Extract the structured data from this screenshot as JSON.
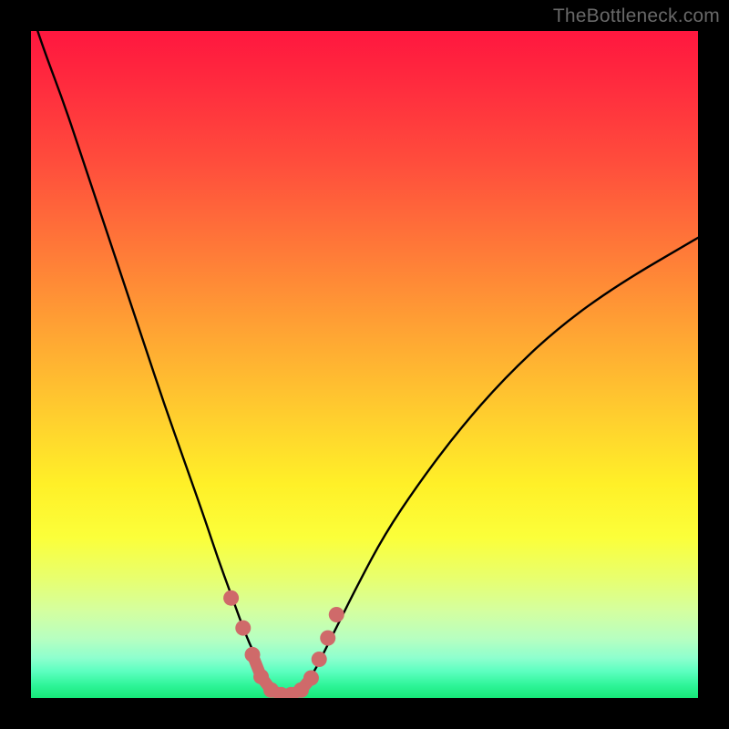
{
  "watermark": "TheBottleneck.com",
  "colors": {
    "background": "#000000",
    "curve": "#000000",
    "marker_fill": "#cf6a6a",
    "marker_stroke": "#cf6a6a"
  },
  "chart_data": {
    "type": "line",
    "title": "",
    "xlabel": "",
    "ylabel": "",
    "xlim": [
      0,
      100
    ],
    "ylim": [
      0,
      100
    ],
    "grid": false,
    "legend": false,
    "series": [
      {
        "name": "bottleneck-curve",
        "x": [
          0,
          2,
          5,
          8,
          11,
          14,
          17,
          20,
          23,
          26,
          28,
          30,
          32,
          33.5,
          35,
          36,
          37,
          38,
          39,
          40,
          41,
          42.5,
          44,
          46,
          49,
          53,
          58,
          64,
          71,
          79,
          88,
          100
        ],
        "y": [
          103,
          97,
          89,
          80,
          71,
          62,
          53,
          44,
          35.5,
          27,
          21,
          15.5,
          10,
          6.5,
          3.5,
          2,
          1,
          0.5,
          0.5,
          1,
          2,
          4,
          7,
          11,
          17,
          24.5,
          32,
          40,
          48,
          55.5,
          62,
          69
        ]
      }
    ],
    "markers": {
      "name": "highlighted-points",
      "points": [
        {
          "x": 30.0,
          "y": 15.0
        },
        {
          "x": 31.8,
          "y": 10.5
        },
        {
          "x": 33.2,
          "y": 6.5
        },
        {
          "x": 34.5,
          "y": 3.2
        },
        {
          "x": 36.0,
          "y": 1.2
        },
        {
          "x": 37.5,
          "y": 0.5
        },
        {
          "x": 39.0,
          "y": 0.5
        },
        {
          "x": 40.5,
          "y": 1.2
        },
        {
          "x": 42.0,
          "y": 3.0
        },
        {
          "x": 43.2,
          "y": 5.8
        },
        {
          "x": 44.5,
          "y": 9.0
        },
        {
          "x": 45.8,
          "y": 12.5
        }
      ],
      "connector": [
        {
          "x": 33.2,
          "y": 6.5
        },
        {
          "x": 34.5,
          "y": 3.2
        },
        {
          "x": 36.0,
          "y": 1.2
        },
        {
          "x": 37.5,
          "y": 0.5
        },
        {
          "x": 39.0,
          "y": 0.5
        },
        {
          "x": 40.5,
          "y": 1.2
        },
        {
          "x": 42.0,
          "y": 3.0
        }
      ]
    }
  }
}
